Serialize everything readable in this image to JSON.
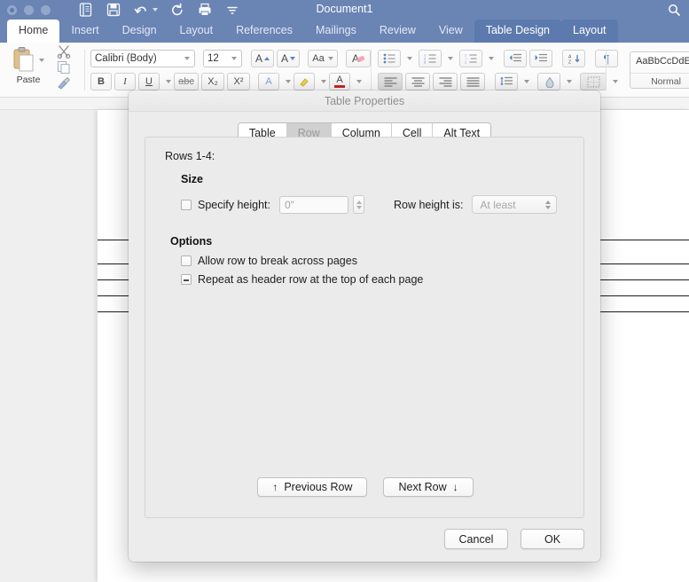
{
  "window": {
    "title": "Document1",
    "traffic_lights": [
      "close",
      "minimize",
      "zoom"
    ],
    "quick_access": [
      {
        "name": "new-document-icon",
        "label": "New"
      },
      {
        "name": "save-icon",
        "label": "Save"
      },
      {
        "name": "undo-icon",
        "label": "Undo"
      },
      {
        "name": "redo-icon",
        "label": "Redo"
      },
      {
        "name": "print-icon",
        "label": "Print"
      },
      {
        "name": "customize-toolbar-icon",
        "label": "Customize"
      }
    ],
    "search_icon": "search-icon"
  },
  "ribbon": {
    "tabs": [
      {
        "label": "Home",
        "state": "active"
      },
      {
        "label": "Insert",
        "state": "normal"
      },
      {
        "label": "Design",
        "state": "normal"
      },
      {
        "label": "Layout",
        "state": "normal"
      },
      {
        "label": "References",
        "state": "normal"
      },
      {
        "label": "Mailings",
        "state": "normal"
      },
      {
        "label": "Review",
        "state": "normal"
      },
      {
        "label": "View",
        "state": "normal"
      },
      {
        "label": "Table Design",
        "state": "context"
      },
      {
        "label": "Layout",
        "state": "context"
      }
    ],
    "clipboard": {
      "paste_label": "Paste",
      "cut_icon": "scissors-icon",
      "copy_icon": "copy-icon",
      "format_painter_icon": "paintbrush-icon"
    },
    "font": {
      "family_value": "Calibri (Body)",
      "size_value": "12",
      "grow_label": "A",
      "shrink_label": "A",
      "change_case_label": "Aa",
      "clear_formatting_label": "A",
      "bold_label": "B",
      "italic_label": "I",
      "underline_label": "U",
      "strikethrough_label": "abc",
      "subscript_label": "X₂",
      "superscript_label": "X²",
      "text_effects_label": "A",
      "highlight_label": "✎",
      "font_color_label": "A"
    },
    "paragraph": {
      "bullets_icon": "bullet-list-icon",
      "numbering_icon": "numbered-list-icon",
      "multilevel_icon": "multilevel-list-icon",
      "decrease_indent_icon": "decrease-indent-icon",
      "increase_indent_icon": "increase-indent-icon",
      "sort_icon": "sort-az-icon",
      "show_marks_label": "¶",
      "align_left_icon": "align-left-icon",
      "align_center_icon": "align-center-icon",
      "align_right_icon": "align-right-icon",
      "justify_icon": "justify-icon",
      "line_spacing_icon": "line-spacing-icon",
      "shading_icon": "shading-icon",
      "borders_icon": "borders-icon"
    },
    "styles": {
      "preview_text": "AaBbCcDdEe",
      "style_name": "Normal"
    }
  },
  "document": {
    "table_row_lines": [
      146,
      173,
      191,
      209,
      227
    ]
  },
  "dialog": {
    "title": "Table Properties",
    "tabs": [
      {
        "label": "Table",
        "selected": false
      },
      {
        "label": "Row",
        "selected": true
      },
      {
        "label": "Column",
        "selected": false
      },
      {
        "label": "Cell",
        "selected": false
      },
      {
        "label": "Alt Text",
        "selected": false
      }
    ],
    "rows_label": "Rows 1-4:",
    "size": {
      "heading": "Size",
      "specify_height_label": "Specify height:",
      "specify_height_checked": false,
      "height_value": "0\"",
      "row_height_is_label": "Row height is:",
      "row_height_is_value": "At least"
    },
    "options": {
      "heading": "Options",
      "items": [
        {
          "label": "Allow row to break across pages",
          "state": "unchecked"
        },
        {
          "label": "Repeat as header row at the top of each page",
          "state": "mixed"
        }
      ]
    },
    "navigation": {
      "previous_label": "Previous Row",
      "previous_icon": "arrow-up-icon",
      "next_label": "Next Row",
      "next_icon": "arrow-down-icon"
    },
    "actions": {
      "cancel_label": "Cancel",
      "ok_label": "OK"
    }
  },
  "colors": {
    "titlebar": "#6a84b4",
    "context_tab": "#5d7aae",
    "dialog_bg": "#ececec",
    "panel_bg": "#ebebeb",
    "selected_seg": "#d0d0d0"
  }
}
